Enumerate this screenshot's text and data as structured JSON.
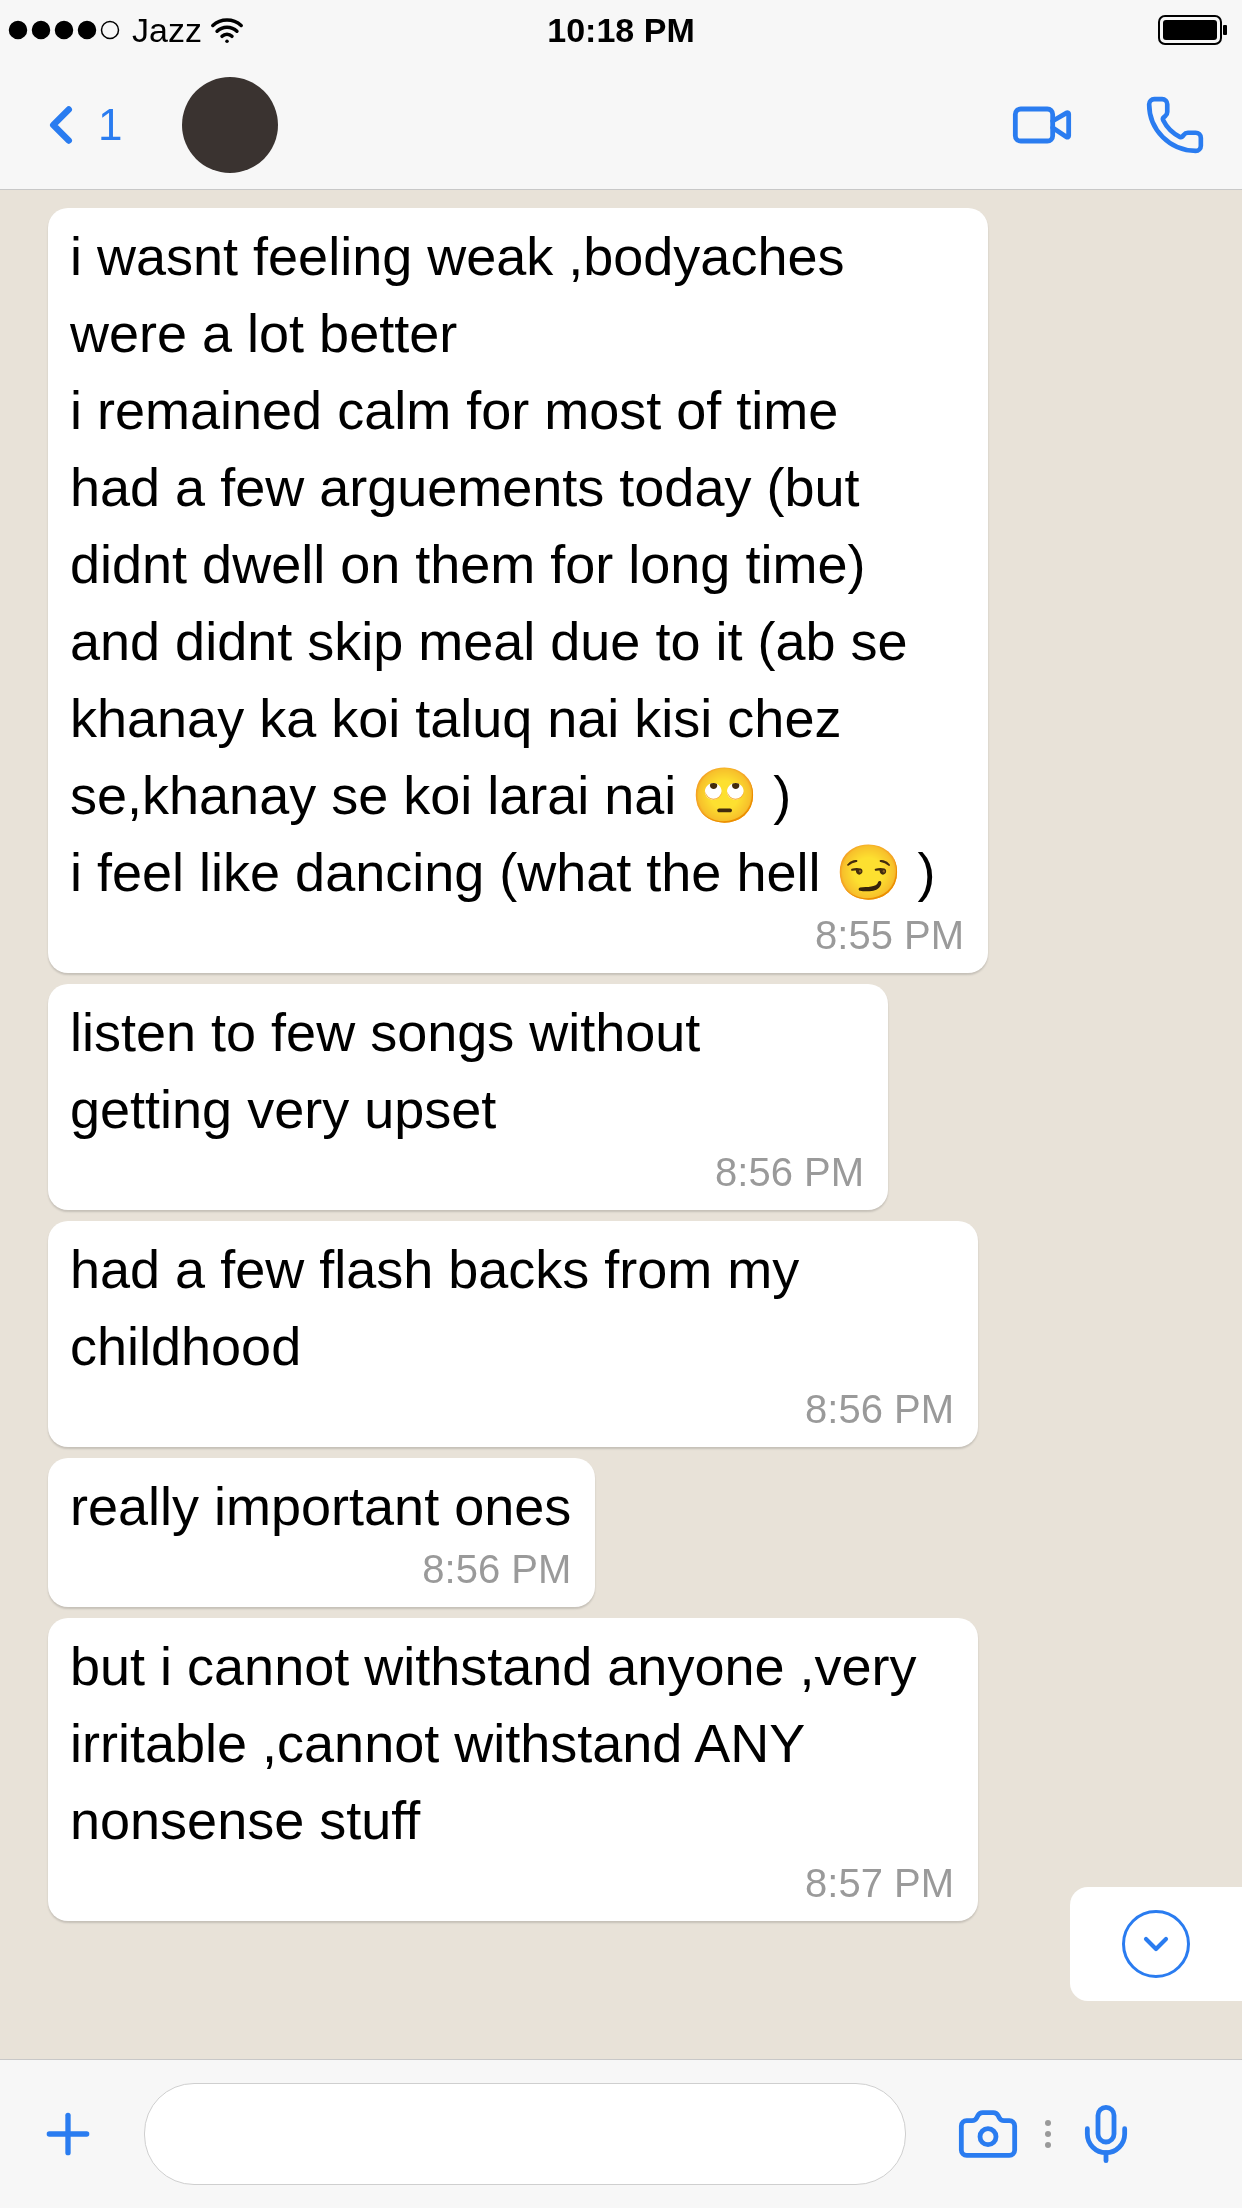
{
  "status_bar": {
    "carrier": "Jazz",
    "time": "10:18 PM"
  },
  "header": {
    "back_count": "1"
  },
  "messages": [
    {
      "text": "i wasnt feeling weak ,bodyaches were a lot better\ni remained calm for most of time\nhad a few arguements today (but didnt dwell on them for long time) and didnt skip meal due to it (ab se khanay ka koi taluq nai kisi chez se,khanay se koi larai nai 🙄 )\ni feel like dancing (what the hell 😏 )",
      "time": "8:55 PM"
    },
    {
      "text": "listen to few songs without getting very upset",
      "time": "8:56 PM"
    },
    {
      "text": "had a few flash backs from my childhood",
      "time": "8:56 PM"
    },
    {
      "text": "really important ones",
      "time": "8:56 PM"
    },
    {
      "text": "but i cannot withstand anyone ,very irritable ,cannot withstand ANY nonsense stuff",
      "time": "8:57 PM"
    }
  ]
}
